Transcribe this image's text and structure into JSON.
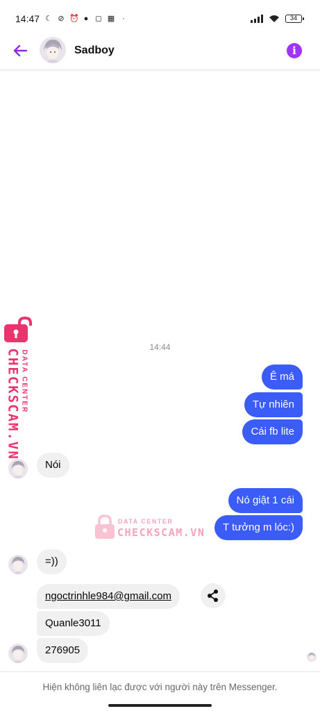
{
  "status_bar": {
    "time": "14:47",
    "battery": "34",
    "left_icons": [
      "moon-icon",
      "mute-icon",
      "alarm-icon",
      "messenger-icon",
      "instagram-icon",
      "momo-icon",
      "dot-icon"
    ]
  },
  "header": {
    "contact_name": "Sadboy",
    "info_glyph": "i"
  },
  "conversation": {
    "timestamp": "14:44",
    "messages": [
      {
        "from": "me",
        "text": "Ê má"
      },
      {
        "from": "me",
        "text": "Tự nhiên"
      },
      {
        "from": "me",
        "text": "Cái fb lite"
      },
      {
        "from": "them",
        "text": "Nói"
      },
      {
        "from": "me",
        "text": "Nó giật 1 cái"
      },
      {
        "from": "me",
        "text": "T tưởng m lóc:)"
      },
      {
        "from": "them",
        "text": "=))"
      },
      {
        "from": "them",
        "text": "ngoctrinhle984@gmail.com"
      },
      {
        "from": "them",
        "text": "Quanle3011"
      },
      {
        "from": "them",
        "text": "276905"
      }
    ]
  },
  "watermark": {
    "brand": "CHECKSCAM.VN",
    "tagline": "DATA CENTER"
  },
  "footer": {
    "notice": "Hiện không liên lạc được với người này trên Messenger."
  },
  "colors": {
    "accent": "#a033ff",
    "outgoing_bubble": "#3b5cf6",
    "incoming_bubble": "#f0f0f0",
    "watermark": "#e8356d"
  }
}
